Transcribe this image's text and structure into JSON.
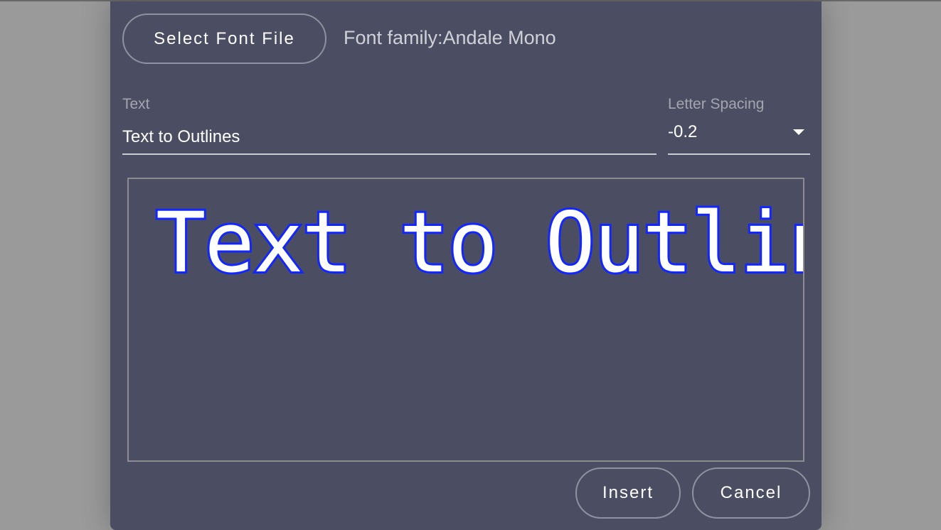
{
  "dialog": {
    "select_font_button": "Select Font File",
    "font_family_label": "Font family:Andale Mono",
    "text_field": {
      "label": "Text",
      "value": "Text to Outlines"
    },
    "letter_spacing": {
      "label": "Letter Spacing",
      "value": "-0.2",
      "icon": "chevron-down-icon"
    },
    "preview": {
      "text": "Text to Outlines",
      "fill_color": "#ffffff",
      "outline_color": "#1226ff"
    },
    "insert_button": "Insert",
    "cancel_button": "Cancel"
  }
}
